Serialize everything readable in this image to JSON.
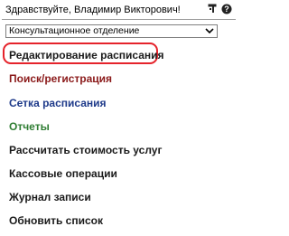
{
  "header": {
    "greeting": "Здравствуйте, Владимир Викторович!",
    "icons": [
      "help-icon",
      "config-icon"
    ]
  },
  "department": {
    "selected": "Консультационное отделение"
  },
  "menu": {
    "items": [
      {
        "label": "Редактирование расписания",
        "color": "#1a1a1a"
      },
      {
        "label": "Поиск/регистрация",
        "color": "#8b1a1a"
      },
      {
        "label": "Сетка расписания",
        "color": "#1e3a8a"
      },
      {
        "label": "Отчеты",
        "color": "#2e7d32"
      },
      {
        "label": "Рассчитать стоимость услуг",
        "color": "#1a1a1a"
      },
      {
        "label": "Кассовые операции",
        "color": "#1a1a1a"
      },
      {
        "label": "Журнал записи",
        "color": "#1a1a1a"
      },
      {
        "label": "Обновить список",
        "color": "#1a1a1a"
      }
    ]
  },
  "colors": {
    "highlight": "#e5232b"
  }
}
